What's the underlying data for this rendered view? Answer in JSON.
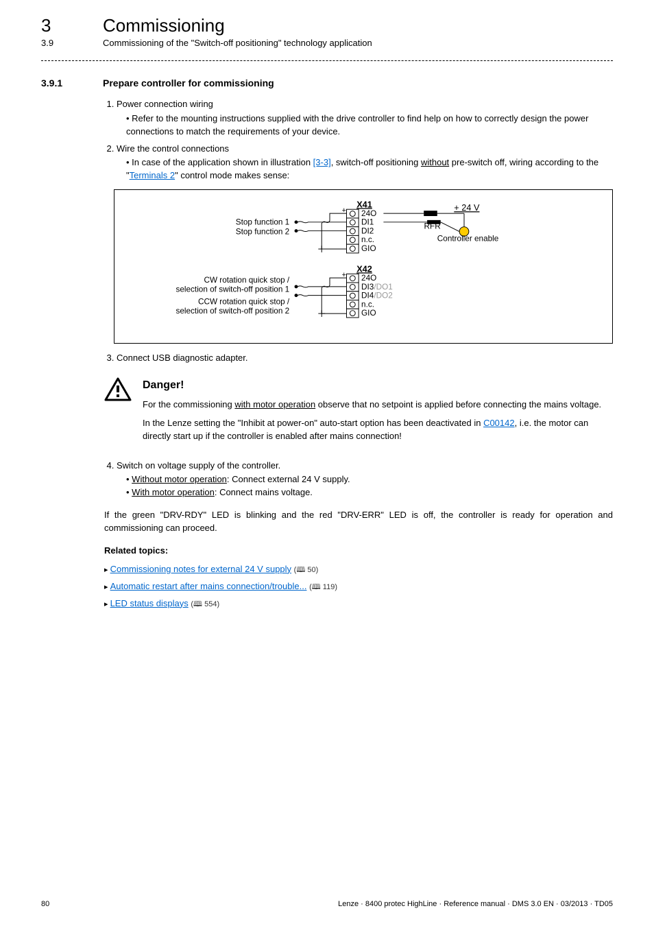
{
  "header": {
    "chapter_num": "3",
    "chapter_title": "Commissioning",
    "section_num": "3.9",
    "section_title": "Commissioning of the \"Switch-off positioning\" technology application"
  },
  "section": {
    "num": "3.9.1",
    "title": "Prepare controller for commissioning"
  },
  "steps": {
    "s1": {
      "label": "Power connection wiring",
      "bullet1": "Refer to the mounting instructions supplied with the drive controller to find help on how to correctly design the power connections to match the requirements of your device."
    },
    "s2": {
      "label": "Wire the control connections",
      "b_pre": "In case of the application shown in illustration ",
      "b_link1": "[3-3]",
      "b_mid1": ", switch-off positioning ",
      "b_u1": "without",
      "b_mid2": " pre-switch off, wiring according to the \"",
      "b_link2": "Terminals 2",
      "b_end": "\" control mode makes sense:"
    },
    "s3": {
      "label": "Connect USB diagnostic adapter."
    },
    "s4": {
      "label": "Switch on voltage supply of the controller.",
      "b1_u": "Without motor operation",
      "b1_t": ": Connect external 24 V supply.",
      "b2_u": "With motor operation",
      "b2_t": ": Connect mains voltage."
    }
  },
  "diagram": {
    "x41": "X41",
    "x42": "X42",
    "t24o": "24O",
    "di1": "DI1",
    "di2": "DI2",
    "di3a": "DI3",
    "di3b": "/DO1",
    "di4a": "DI4",
    "di4b": "/DO2",
    "nc": "n.c.",
    "gio": "GIO",
    "stop1": "Stop function 1",
    "stop2": "Stop function 2",
    "cw1": "CW rotation quick stop /",
    "cw2": "selection of switch-off position 1",
    "ccw1": "CCW rotation quick stop /",
    "ccw2": "selection of switch-off position 2",
    "v24": "+ 24 V",
    "rfr": "RFR",
    "ctrl_en": "Controller enable",
    "plus": "+"
  },
  "danger": {
    "title": "Danger!",
    "p1_a": "For the commissioning ",
    "p1_u": "with motor operation",
    "p1_b": " observe that no setpoint is applied before connecting the mains voltage.",
    "p2_a": "In the Lenze setting the   \"Inhibit at power-on\" auto-start option has been deactivated in ",
    "p2_link": "C00142",
    "p2_b": ", i.e. the motor can directly start up if the controller is enabled after mains connection!"
  },
  "closing": "If the green \"DRV-RDY\" LED is blinking and the red \"DRV-ERR\" LED is off, the controller is ready for operation and commissioning can proceed.",
  "related": {
    "title": "Related topics:",
    "r1": {
      "text": "Commissioning notes for external 24 V supply",
      "page": "50"
    },
    "r2": {
      "text": "Automatic restart after mains connection/trouble...",
      "page": "119"
    },
    "r3": {
      "text": "LED status displays",
      "page": "554"
    }
  },
  "footer": {
    "page": "80",
    "info": "Lenze · 8400 protec HighLine · Reference manual · DMS 3.0 EN · 03/2013 · TD05"
  }
}
